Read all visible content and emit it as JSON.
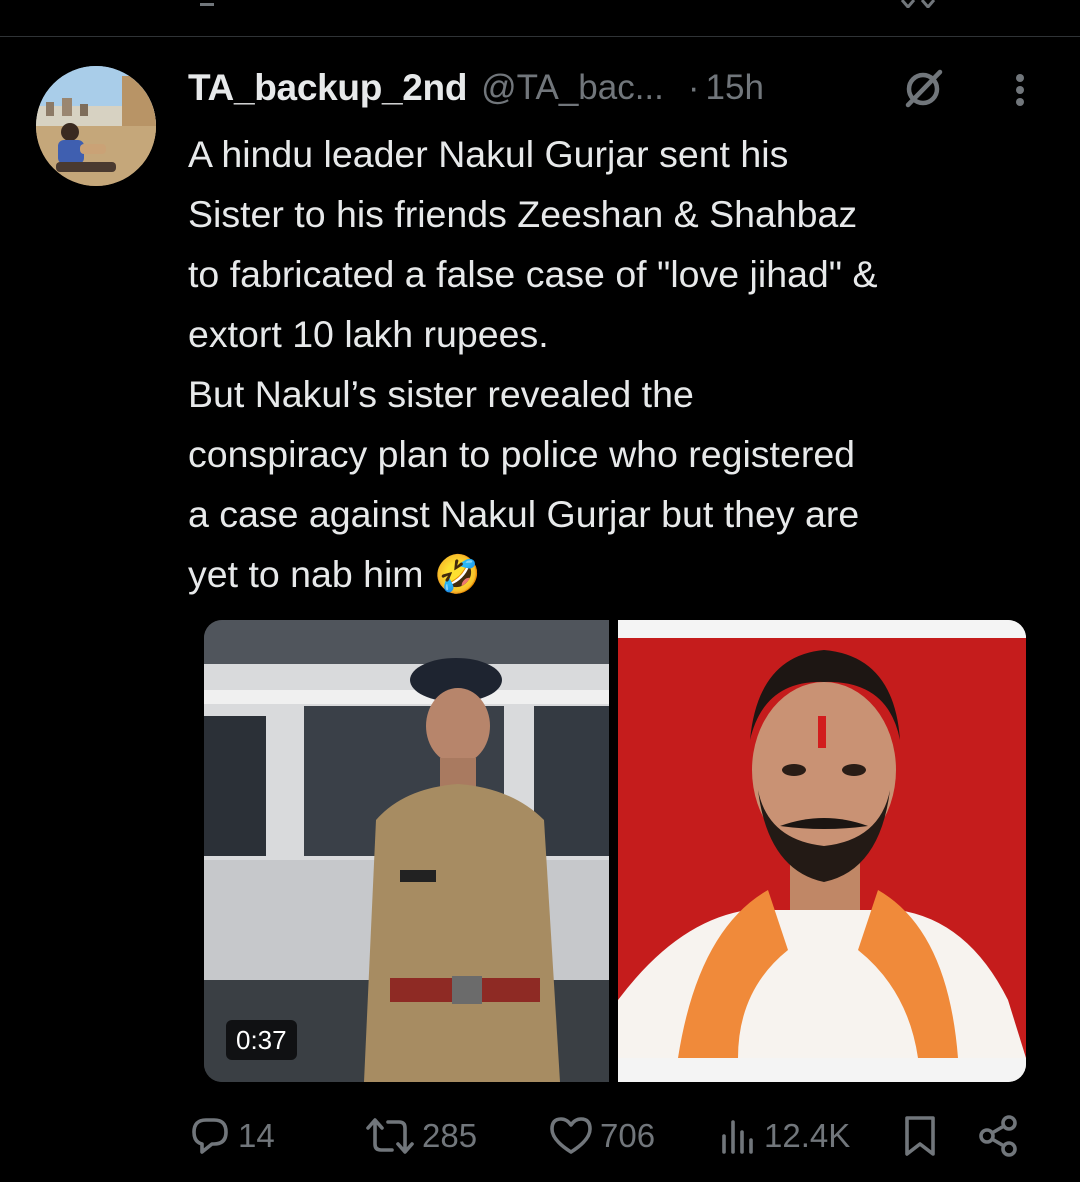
{
  "post": {
    "author": {
      "display_name": "TA_backup_2nd",
      "handle": "@TA_bac...",
      "separator": "·",
      "time": "15h"
    },
    "text_lines": [
      "A hindu leader Nakul Gurjar sent his",
      "Sister to his friends Zeeshan & Shahbaz",
      "to fabricated a false case of \"love jihad\" &",
      "extort 10 lakh rupees.",
      "But Nakul’s sister revealed the",
      "conspiracy plan to police who registered",
      "a case against Nakul Gurjar but they are",
      "yet to nab him 🤣"
    ],
    "media": {
      "video_duration": "0:37"
    },
    "actions": {
      "replies": "14",
      "reposts": "285",
      "likes": "706",
      "views": "12.4K"
    },
    "icons": [
      "grok-icon",
      "more-icon",
      "reply-icon",
      "repost-icon",
      "like-icon",
      "views-icon",
      "bookmark-icon",
      "share-icon"
    ],
    "colors": {
      "background": "#000000",
      "primary_text": "#e7e9ea",
      "secondary_text": "#71767b",
      "divider": "#2f3336"
    }
  }
}
